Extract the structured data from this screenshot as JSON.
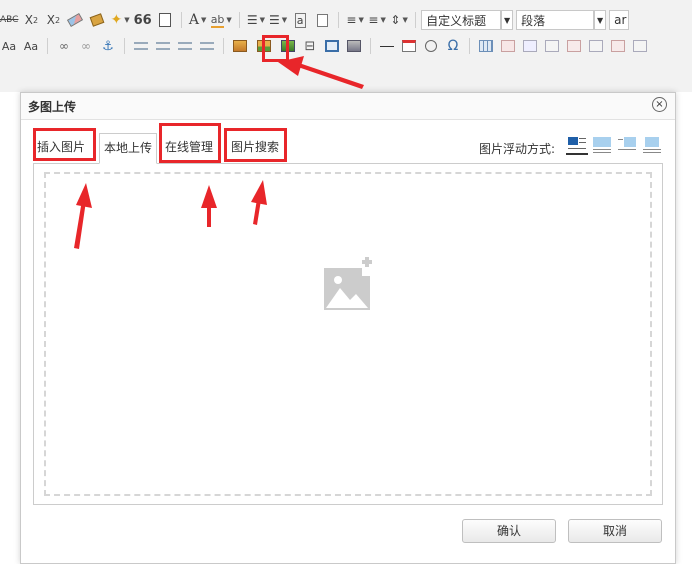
{
  "toolbar": {
    "row1": {
      "strikethrough": "ABC",
      "superscript_base": "X",
      "superscript_exp": "2",
      "subscript_base": "X",
      "subscript_sub": "2",
      "quote": "66",
      "font_color": "A",
      "spellcheck": "ab",
      "heading_select": "自定义标题",
      "paragraph_select": "段落",
      "font_select": "ar"
    },
    "row2": {
      "left_icons": [
        "Aa",
        "Aa"
      ],
      "anchor_icon": "⚓",
      "omega": "Ω"
    }
  },
  "dialog": {
    "title": "多图上传",
    "close": "×",
    "tabs": [
      "插入图片",
      "本地上传",
      "在线管理",
      "图片搜索"
    ],
    "active_tab": "本地上传",
    "float_label": "图片浮动方式:",
    "confirm": "确认",
    "cancel": "取消"
  },
  "colors": {
    "highlight": "#e8262a",
    "toolbar_bg": "#f2f2f2",
    "placeholder": "#cccccc"
  }
}
